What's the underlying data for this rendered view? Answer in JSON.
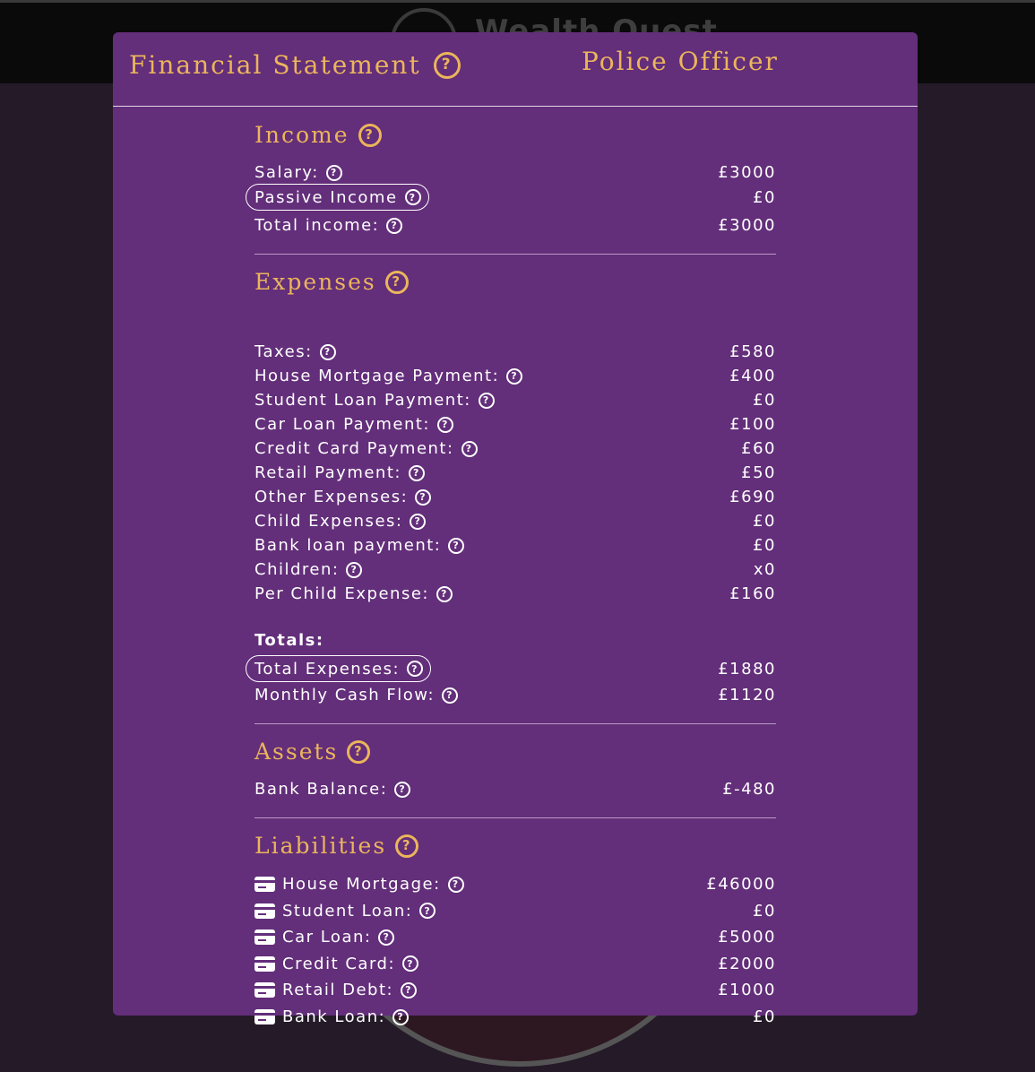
{
  "background": {
    "brand_title": "Wealth Quest"
  },
  "modal": {
    "title": "Financial Statement",
    "role": "Police Officer",
    "help_glyph": "?"
  },
  "income": {
    "title": "Income",
    "rows": [
      {
        "label": "Salary:",
        "value": "£3000"
      },
      {
        "label": "Passive Income",
        "value": "£0"
      },
      {
        "label": "Total income:",
        "value": "£3000"
      }
    ]
  },
  "expenses": {
    "title": "Expenses",
    "rows": [
      {
        "label": "Taxes:",
        "value": "£580"
      },
      {
        "label": "House Mortgage Payment:",
        "value": "£400"
      },
      {
        "label": "Student Loan Payment:",
        "value": "£0"
      },
      {
        "label": "Car Loan Payment:",
        "value": "£100"
      },
      {
        "label": "Credit Card Payment:",
        "value": "£60"
      },
      {
        "label": "Retail Payment:",
        "value": "£50"
      },
      {
        "label": "Other Expenses:",
        "value": "£690"
      },
      {
        "label": "Child Expenses:",
        "value": "£0"
      },
      {
        "label": "Bank loan payment:",
        "value": "£0"
      },
      {
        "label": "Children:",
        "value": "x0"
      },
      {
        "label": "Per Child Expense:",
        "value": "£160"
      }
    ]
  },
  "totals": {
    "heading": "Totals:",
    "rows": [
      {
        "label": "Total Expenses:",
        "value": "£1880"
      },
      {
        "label": "Monthly Cash Flow:",
        "value": "£1120"
      }
    ]
  },
  "assets": {
    "title": "Assets",
    "rows": [
      {
        "label": "Bank Balance:",
        "value": "£-480"
      }
    ]
  },
  "liabilities": {
    "title": "Liabilities",
    "rows": [
      {
        "label": "House Mortgage:",
        "value": "£46000"
      },
      {
        "label": "Student Loan:",
        "value": "£0"
      },
      {
        "label": "Car Loan:",
        "value": "£5000"
      },
      {
        "label": "Credit Card:",
        "value": "£2000"
      },
      {
        "label": "Retail Debt:",
        "value": "£1000"
      },
      {
        "label": "Bank Loan:",
        "value": "£0"
      }
    ]
  },
  "colors": {
    "modal_bg": "#632e7a",
    "accent_gold": "#ebb55c",
    "page_bg": "#241a28"
  },
  "icons": {
    "help": "question-circle-icon",
    "liability": "credit-card-icon"
  }
}
